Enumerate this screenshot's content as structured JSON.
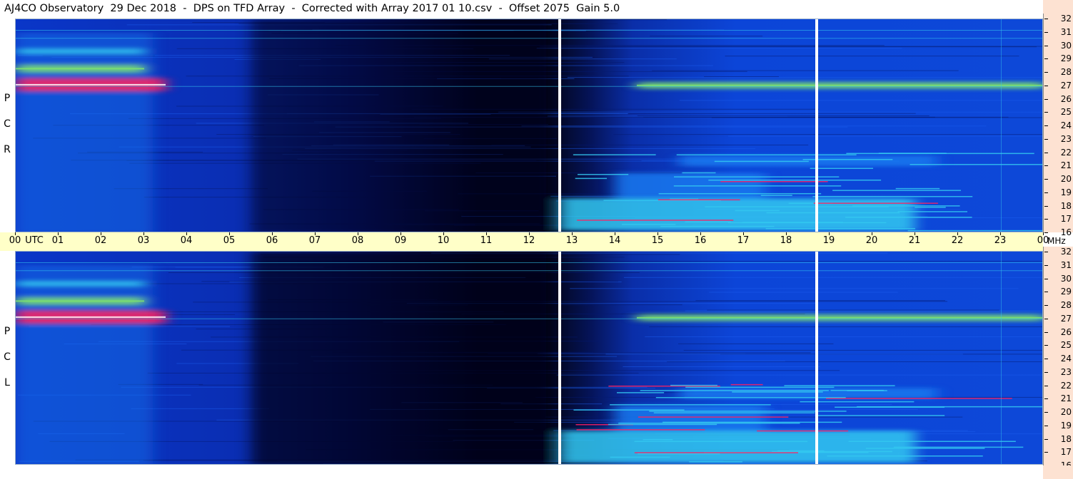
{
  "title": "AJ4CO Observatory  29 Dec 2018  -  DPS on TFD Array  -  Corrected with Array 2017 01 10.csv  -  Offset 2075  Gain 5.0",
  "colors": {
    "background_dark": "#02051a",
    "background_blue": "#0a36c8",
    "mid_blue": "#1a78ee",
    "cyan": "#34c8f0",
    "green": "#7ee070",
    "hot": "#ff2060",
    "time_axis_bg": "#ffffc8",
    "freq_axis_bg": "#fde2d2"
  },
  "chart_data": {
    "type": "heatmap",
    "title": "AJ4CO Observatory  29 Dec 2018  -  DPS on TFD Array  -  Corrected with Array 2017 01 10.csv  -  Offset 2075  Gain 5.0",
    "x_axis": {
      "tick_labels": [
        "00",
        "UTC",
        "01",
        "02",
        "03",
        "04",
        "05",
        "06",
        "07",
        "08",
        "09",
        "10",
        "11",
        "12",
        "13",
        "14",
        "15",
        "16",
        "17",
        "18",
        "19",
        "20",
        "21",
        "22",
        "23",
        "00"
      ],
      "unit": "MHz",
      "range": [
        0,
        24
      ]
    },
    "y_axis": {
      "tick_labels": [
        "32",
        "31",
        "30",
        "29",
        "28",
        "27",
        "26",
        "25",
        "24",
        "23",
        "22",
        "21",
        "20",
        "19",
        "18",
        "17",
        "16"
      ],
      "range": [
        16,
        32
      ]
    },
    "panels": [
      {
        "name": "R C P",
        "letters": [
          "R",
          "C",
          "P"
        ]
      },
      {
        "name": "L C P",
        "letters": [
          "L",
          "C",
          "P"
        ]
      }
    ],
    "gaps_utc": [
      12.7,
      18.7
    ],
    "features": [
      {
        "desc": "broadband",
        "t_start": 0.0,
        "t_end": 3.2,
        "f_low": 16,
        "f_high": 31,
        "level": 0.55
      },
      {
        "desc": "band",
        "t_start": 0.0,
        "t_end": 3.5,
        "f_low": 26.6,
        "f_high": 27.6,
        "level": 1.0
      },
      {
        "desc": "band",
        "t_start": 0.0,
        "t_end": 3.0,
        "f_low": 28.0,
        "f_high": 28.6,
        "level": 0.85
      },
      {
        "desc": "band",
        "t_start": 0.0,
        "t_end": 3.0,
        "f_low": 29.4,
        "f_high": 29.8,
        "level": 0.6
      },
      {
        "desc": "band",
        "t_start": 14.5,
        "t_end": 24.0,
        "f_low": 26.8,
        "f_high": 27.3,
        "level": 0.85
      },
      {
        "desc": "band",
        "t_start": 12.7,
        "t_end": 21.0,
        "f_low": 16.2,
        "f_high": 18.6,
        "level": 0.7
      },
      {
        "desc": "band",
        "t_start": 14.0,
        "t_end": 17.5,
        "f_low": 18.6,
        "f_high": 20.5,
        "level": 0.55
      },
      {
        "desc": "band",
        "t_start": 15.5,
        "t_end": 21.5,
        "f_low": 21.0,
        "f_high": 21.8,
        "level": 0.5
      },
      {
        "desc": "dark",
        "t_start": 5.5,
        "t_end": 12.5,
        "f_low": 16,
        "f_high": 32,
        "level": 0.0
      }
    ]
  }
}
